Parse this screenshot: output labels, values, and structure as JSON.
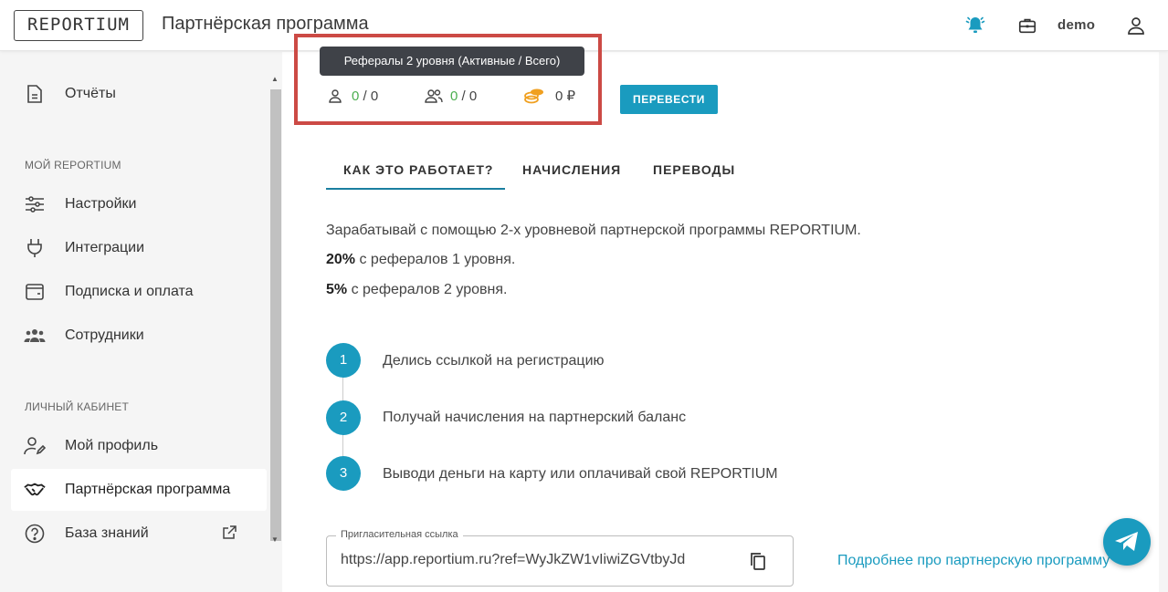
{
  "header": {
    "logo": "REPORTIUM",
    "title": "Партнёрская программа",
    "user": "demo",
    "bell_color": "#1a9bbf"
  },
  "sidebar": {
    "items": [
      {
        "label": "Отчёты",
        "icon": "document-icon"
      },
      {
        "label": "Настройки",
        "icon": "sliders-icon"
      },
      {
        "label": "Интеграции",
        "icon": "plug-icon"
      },
      {
        "label": "Подписка и оплата",
        "icon": "wallet-icon"
      },
      {
        "label": "Сотрудники",
        "icon": "group-icon"
      },
      {
        "label": "Мой профиль",
        "icon": "user-edit-icon"
      },
      {
        "label": "Партнёрская программа",
        "icon": "handshake-icon",
        "active": true
      },
      {
        "label": "База знаний",
        "icon": "help-circle-icon"
      }
    ],
    "sections": {
      "my": "МОЙ REPORTIUM",
      "personal": "ЛИЧНЫЙ КАБИНЕТ"
    }
  },
  "stats": {
    "tooltip": "Рефералы 2 уровня (Активные / Всего)",
    "level1_active": "0",
    "level1_total": " / 0",
    "level2_active": "0",
    "level2_total": " / 0",
    "balance": "0 ₽",
    "transfer_label": "ПЕРЕВЕСТИ"
  },
  "tabs": [
    {
      "label": "КАК ЭТО РАБОТАЕТ?",
      "active": true
    },
    {
      "label": "НАЧИСЛЕНИЯ"
    },
    {
      "label": "ПЕРЕВОДЫ"
    }
  ],
  "info": {
    "intro": "Зарабатывай с помощью 2-х уровневой партнерской программы REPORTIUM.",
    "l1_percent": "20%",
    "l1_text": " с рефералов 1 уровня.",
    "l2_percent": "5%",
    "l2_text": " с рефералов 2 уровня."
  },
  "steps": [
    {
      "num": "1",
      "text": "Делись ссылкой на регистрацию"
    },
    {
      "num": "2",
      "text": "Получай начисления на партнерский баланс"
    },
    {
      "num": "3",
      "text": "Выводи деньги на карту или оплачивай свой REPORTIUM"
    }
  ],
  "invite": {
    "label": "Пригласительная ссылка",
    "url": "https://app.reportium.ru?ref=WyJkZW1vIiwiZGVtbyJd",
    "more_link": "Подробнее про партнерскую программу"
  },
  "colors": {
    "accent": "#1a9bbf",
    "green": "#4caf50",
    "coins": "#f0a020",
    "highlight": "#cc4a45"
  }
}
